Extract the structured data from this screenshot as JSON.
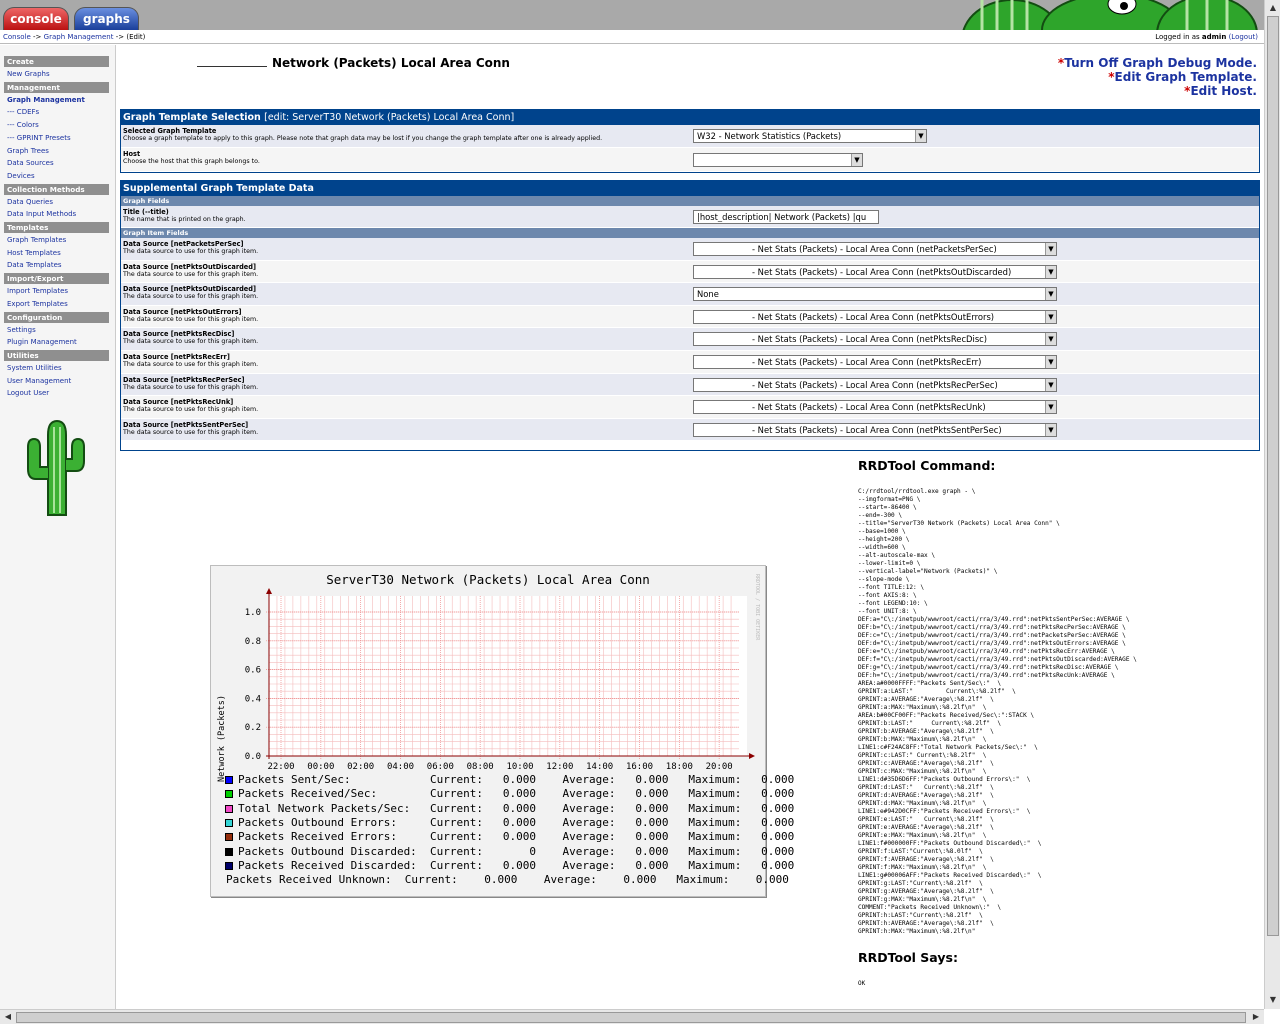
{
  "tabs": {
    "console": "console",
    "graphs": "graphs"
  },
  "breadcrumb": {
    "console": "Console",
    "sep1": "->",
    "graph_management": "Graph Management",
    "sep2": "->",
    "edit": "(Edit)"
  },
  "login": {
    "prefix": "Logged in as",
    "user": "admin",
    "logout": "(Logout)"
  },
  "sidebar": {
    "create": "Create",
    "new_graphs": "New Graphs",
    "management": "Management",
    "graph_management": "Graph Management",
    "cdefs": "--- CDEFs",
    "colors": "--- Colors",
    "gprint_presets": "--- GPRINT Presets",
    "graph_trees": "Graph Trees",
    "data_sources": "Data Sources",
    "devices": "Devices",
    "collection_methods": "Collection Methods",
    "data_queries": "Data Queries",
    "data_input_methods": "Data Input Methods",
    "templates": "Templates",
    "graph_templates": "Graph Templates",
    "host_templates": "Host Templates",
    "data_templates": "Data Templates",
    "import_export": "Import/Export",
    "import_templates": "Import Templates",
    "export_templates": "Export Templates",
    "configuration": "Configuration",
    "settings": "Settings",
    "plugin_management": "Plugin Management",
    "utilities": "Utilities",
    "system_utilities": "System Utilities",
    "user_management": "User Management",
    "logout_user": "Logout User"
  },
  "heading": {
    "title": "Network (Packets) Local Area Conn"
  },
  "actions": {
    "star": "*",
    "debug": "Turn Off Graph Debug Mode.",
    "edit_template": "Edit Graph Template.",
    "edit_host": "Edit Host."
  },
  "template_panel": {
    "title": "Graph Template Selection",
    "subtitle": "[edit: ServerT30 Network (Packets) Local Area Conn]",
    "selected_label": "Selected Graph Template",
    "selected_desc": "Choose a graph template to apply to this graph. Please note that graph data may be lost if you change the graph template after one is already applied.",
    "selected_value": "W32 - Network Statistics (Packets)",
    "host_label": "Host",
    "host_desc": "Choose the host that this graph belongs to.",
    "host_value": ""
  },
  "supplemental": {
    "title": "Supplemental Graph Template Data",
    "graph_fields": "Graph Fields",
    "title_label": "Title (--title)",
    "title_desc": "The name that is printed on the graph.",
    "title_value": "|host_description| Network (Packets) |qu",
    "graph_item_fields": "Graph Item Fields",
    "items": [
      {
        "label": "Data Source [netPacketsPerSec]",
        "desc": "The data source to use for this graph item.",
        "value": "- Net Stats (Packets) - Local Area Conn (netPacketsPerSec)"
      },
      {
        "label": "Data Source [netPktsOutDiscarded]",
        "desc": "The data source to use for this graph item.",
        "value": "- Net Stats (Packets) - Local Area Conn (netPktsOutDiscarded)"
      },
      {
        "label": "Data Source [netPktsOutDiscarded]",
        "desc": "The data source to use for this graph item.",
        "value": "None"
      },
      {
        "label": "Data Source [netPktsOutErrors]",
        "desc": "The data source to use for this graph item.",
        "value": "- Net Stats (Packets) - Local Area Conn (netPktsOutErrors)"
      },
      {
        "label": "Data Source [netPktsRecDisc]",
        "desc": "The data source to use for this graph item.",
        "value": "- Net Stats (Packets) - Local Area Conn (netPktsRecDisc)"
      },
      {
        "label": "Data Source [netPktsRecErr]",
        "desc": "The data source to use for this graph item.",
        "value": "- Net Stats (Packets) - Local Area Conn (netPktsRecErr)"
      },
      {
        "label": "Data Source [netPktsRecPerSec]",
        "desc": "The data source to use for this graph item.",
        "value": "- Net Stats (Packets) - Local Area Conn (netPktsRecPerSec)"
      },
      {
        "label": "Data Source [netPktsRecUnk]",
        "desc": "The data source to use for this graph item.",
        "value": "- Net Stats (Packets) - Local Area Conn (netPktsRecUnk)"
      },
      {
        "label": "Data Source [netPktsSentPerSec]",
        "desc": "The data source to use for this graph item.",
        "value": "- Net Stats (Packets) - Local Area Conn (netPktsSentPerSec)"
      }
    ]
  },
  "graph": {
    "title": "ServerT30 Network (Packets) Local Area Conn",
    "ylabel": "Network (Packets)",
    "side_tag": "RRDTOOL / TOBI OETIKER",
    "yticks": [
      "1.0",
      "0.8",
      "0.6",
      "0.4",
      "0.2",
      "0.0"
    ],
    "xticks": [
      "22:00",
      "00:00",
      "02:00",
      "04:00",
      "06:00",
      "08:00",
      "10:00",
      "12:00",
      "14:00",
      "16:00",
      "18:00",
      "20:00"
    ],
    "legend": [
      {
        "color": "#0000FF",
        "text": "Packets Sent/Sec:            Current:   0.000    Average:   0.000   Maximum:   0.000"
      },
      {
        "color": "#00CF00",
        "text": "Packets Received/Sec:        Current:   0.000    Average:   0.000   Maximum:   0.000"
      },
      {
        "color": "#F24AC8",
        "text": "Total Network Packets/Sec:   Current:   0.000    Average:   0.000   Maximum:   0.000"
      },
      {
        "color": "#35D6D6",
        "text": "Packets Outbound Errors:     Current:   0.000    Average:   0.000   Maximum:   0.000"
      },
      {
        "color": "#942D0C",
        "text": "Packets Received Errors:     Current:   0.000    Average:   0.000   Maximum:   0.000"
      },
      {
        "color": "#000000",
        "text": "Packets Outbound Discarded:  Current:       0    Average:   0.000   Maximum:   0.000"
      },
      {
        "color": "#00006A",
        "text": "Packets Received Discarded:  Current:   0.000    Average:   0.000   Maximum:   0.000"
      }
    ],
    "unknown_line": "Packets Received Unknown:  Current:    0.000    Average:    0.000   Maximum:    0.000"
  },
  "chart_data": {
    "type": "area",
    "title": "ServerT30 Network (Packets) Local Area Conn",
    "ylabel": "Network (Packets)",
    "xlabel": "",
    "categories": [
      "22:00",
      "00:00",
      "02:00",
      "04:00",
      "06:00",
      "08:00",
      "10:00",
      "12:00",
      "14:00",
      "16:00",
      "18:00",
      "20:00"
    ],
    "ylim": [
      0,
      1.0
    ],
    "grid": true,
    "series": [
      {
        "name": "Packets Sent/Sec",
        "values": [
          0,
          0,
          0,
          0,
          0,
          0,
          0,
          0,
          0,
          0,
          0,
          0
        ]
      },
      {
        "name": "Packets Received/Sec",
        "values": [
          0,
          0,
          0,
          0,
          0,
          0,
          0,
          0,
          0,
          0,
          0,
          0
        ]
      },
      {
        "name": "Total Network Packets/Sec",
        "values": [
          0,
          0,
          0,
          0,
          0,
          0,
          0,
          0,
          0,
          0,
          0,
          0
        ]
      },
      {
        "name": "Packets Outbound Errors",
        "values": [
          0,
          0,
          0,
          0,
          0,
          0,
          0,
          0,
          0,
          0,
          0,
          0
        ]
      },
      {
        "name": "Packets Received Errors",
        "values": [
          0,
          0,
          0,
          0,
          0,
          0,
          0,
          0,
          0,
          0,
          0,
          0
        ]
      },
      {
        "name": "Packets Outbound Discarded",
        "values": [
          0,
          0,
          0,
          0,
          0,
          0,
          0,
          0,
          0,
          0,
          0,
          0
        ]
      },
      {
        "name": "Packets Received Discarded",
        "values": [
          0,
          0,
          0,
          0,
          0,
          0,
          0,
          0,
          0,
          0,
          0,
          0
        ]
      }
    ]
  },
  "rrd": {
    "title": "RRDTool Command:",
    "command": "C:/rrdtool/rrdtool.exe graph - \\\n--imgformat=PNG \\\n--start=-86400 \\\n--end=-300 \\\n--title=\"ServerT30 Network (Packets) Local Area Conn\" \\\n--base=1000 \\\n--height=200 \\\n--width=600 \\\n--alt-autoscale-max \\\n--lower-limit=0 \\\n--vertical-label=\"Network (Packets)\" \\\n--slope-mode \\\n--font TITLE:12: \\\n--font AXIS:8: \\\n--font LEGEND:10: \\\n--font UNIT:8: \\\nDEF:a=\"C\\:/inetpub/wwwroot/cacti/rra/3/49.rrd\":netPktsSentPerSec:AVERAGE \\\nDEF:b=\"C\\:/inetpub/wwwroot/cacti/rra/3/49.rrd\":netPktsRecPerSec:AVERAGE \\\nDEF:c=\"C\\:/inetpub/wwwroot/cacti/rra/3/49.rrd\":netPacketsPerSec:AVERAGE \\\nDEF:d=\"C\\:/inetpub/wwwroot/cacti/rra/3/49.rrd\":netPktsOutErrors:AVERAGE \\\nDEF:e=\"C\\:/inetpub/wwwroot/cacti/rra/3/49.rrd\":netPktsRecErr:AVERAGE \\\nDEF:f=\"C\\:/inetpub/wwwroot/cacti/rra/3/49.rrd\":netPktsOutDiscarded:AVERAGE \\\nDEF:g=\"C\\:/inetpub/wwwroot/cacti/rra/3/49.rrd\":netPktsRecDisc:AVERAGE \\\nDEF:h=\"C\\:/inetpub/wwwroot/cacti/rra/3/49.rrd\":netPktsRecUnk:AVERAGE \\\nAREA:a#0000FFFF:\"Packets Sent/Sec\\:\"  \\\nGPRINT:a:LAST:\"         Current\\:%8.2lf\"  \\\nGPRINT:a:AVERAGE:\"Average\\:%8.2lf\"  \\\nGPRINT:a:MAX:\"Maximum\\:%8.2lf\\n\"  \\\nAREA:b#00CF00FF:\"Packets Received/Sec\\:\":STACK \\\nGPRINT:b:LAST:\"     Current\\:%8.2lf\"  \\\nGPRINT:b:AVERAGE:\"Average\\:%8.2lf\"  \\\nGPRINT:b:MAX:\"Maximum\\:%8.2lf\\n\"  \\\nLINE1:c#F24AC8FF:\"Total Network Packets/Sec\\:\"  \\\nGPRINT:c:LAST:\" Current\\:%8.2lf\"  \\\nGPRINT:c:AVERAGE:\"Average\\:%8.2lf\"  \\\nGPRINT:c:MAX:\"Maximum\\:%8.2lf\\n\"  \\\nLINE1:d#35D6D6FF:\"Packets Outbound Errors\\:\"  \\\nGPRINT:d:LAST:\"   Current\\:%8.2lf\"  \\\nGPRINT:d:AVERAGE:\"Average\\:%8.2lf\"  \\\nGPRINT:d:MAX:\"Maximum\\:%8.2lf\\n\"  \\\nLINE1:e#942D0CFF:\"Packets Received Errors\\:\"  \\\nGPRINT:e:LAST:\"   Current\\:%8.2lf\"  \\\nGPRINT:e:AVERAGE:\"Average\\:%8.2lf\"  \\\nGPRINT:e:MAX:\"Maximum\\:%8.2lf\\n\"  \\\nLINE1:f#000000FF:\"Packets Outbound Discarded\\:\"  \\\nGPRINT:f:LAST:\"Current\\:%8.0lf\"  \\\nGPRINT:f:AVERAGE:\"Average\\:%8.2lf\"  \\\nGPRINT:f:MAX:\"Maximum\\:%8.2lf\\n\"  \\\nLINE1:g#00006AFF:\"Packets Received Discarded\\:\"  \\\nGPRINT:g:LAST:\"Current\\:%8.2lf\"  \\\nGPRINT:g:AVERAGE:\"Average\\:%8.2lf\"  \\\nGPRINT:g:MAX:\"Maximum\\:%8.2lf\\n\"  \\\nCOMMENT:\"Packets Received Unknown\\:\"  \\\nGPRINT:h:LAST:\"Current\\:%8.2lf\"  \\\nGPRINT:h:AVERAGE:\"Average\\:%8.2lf\"  \\\nGPRINT:h:MAX:\"Maximum\\:%8.2lf\\n\"",
    "says_title": "RRDTool Says:",
    "says": "OK"
  }
}
